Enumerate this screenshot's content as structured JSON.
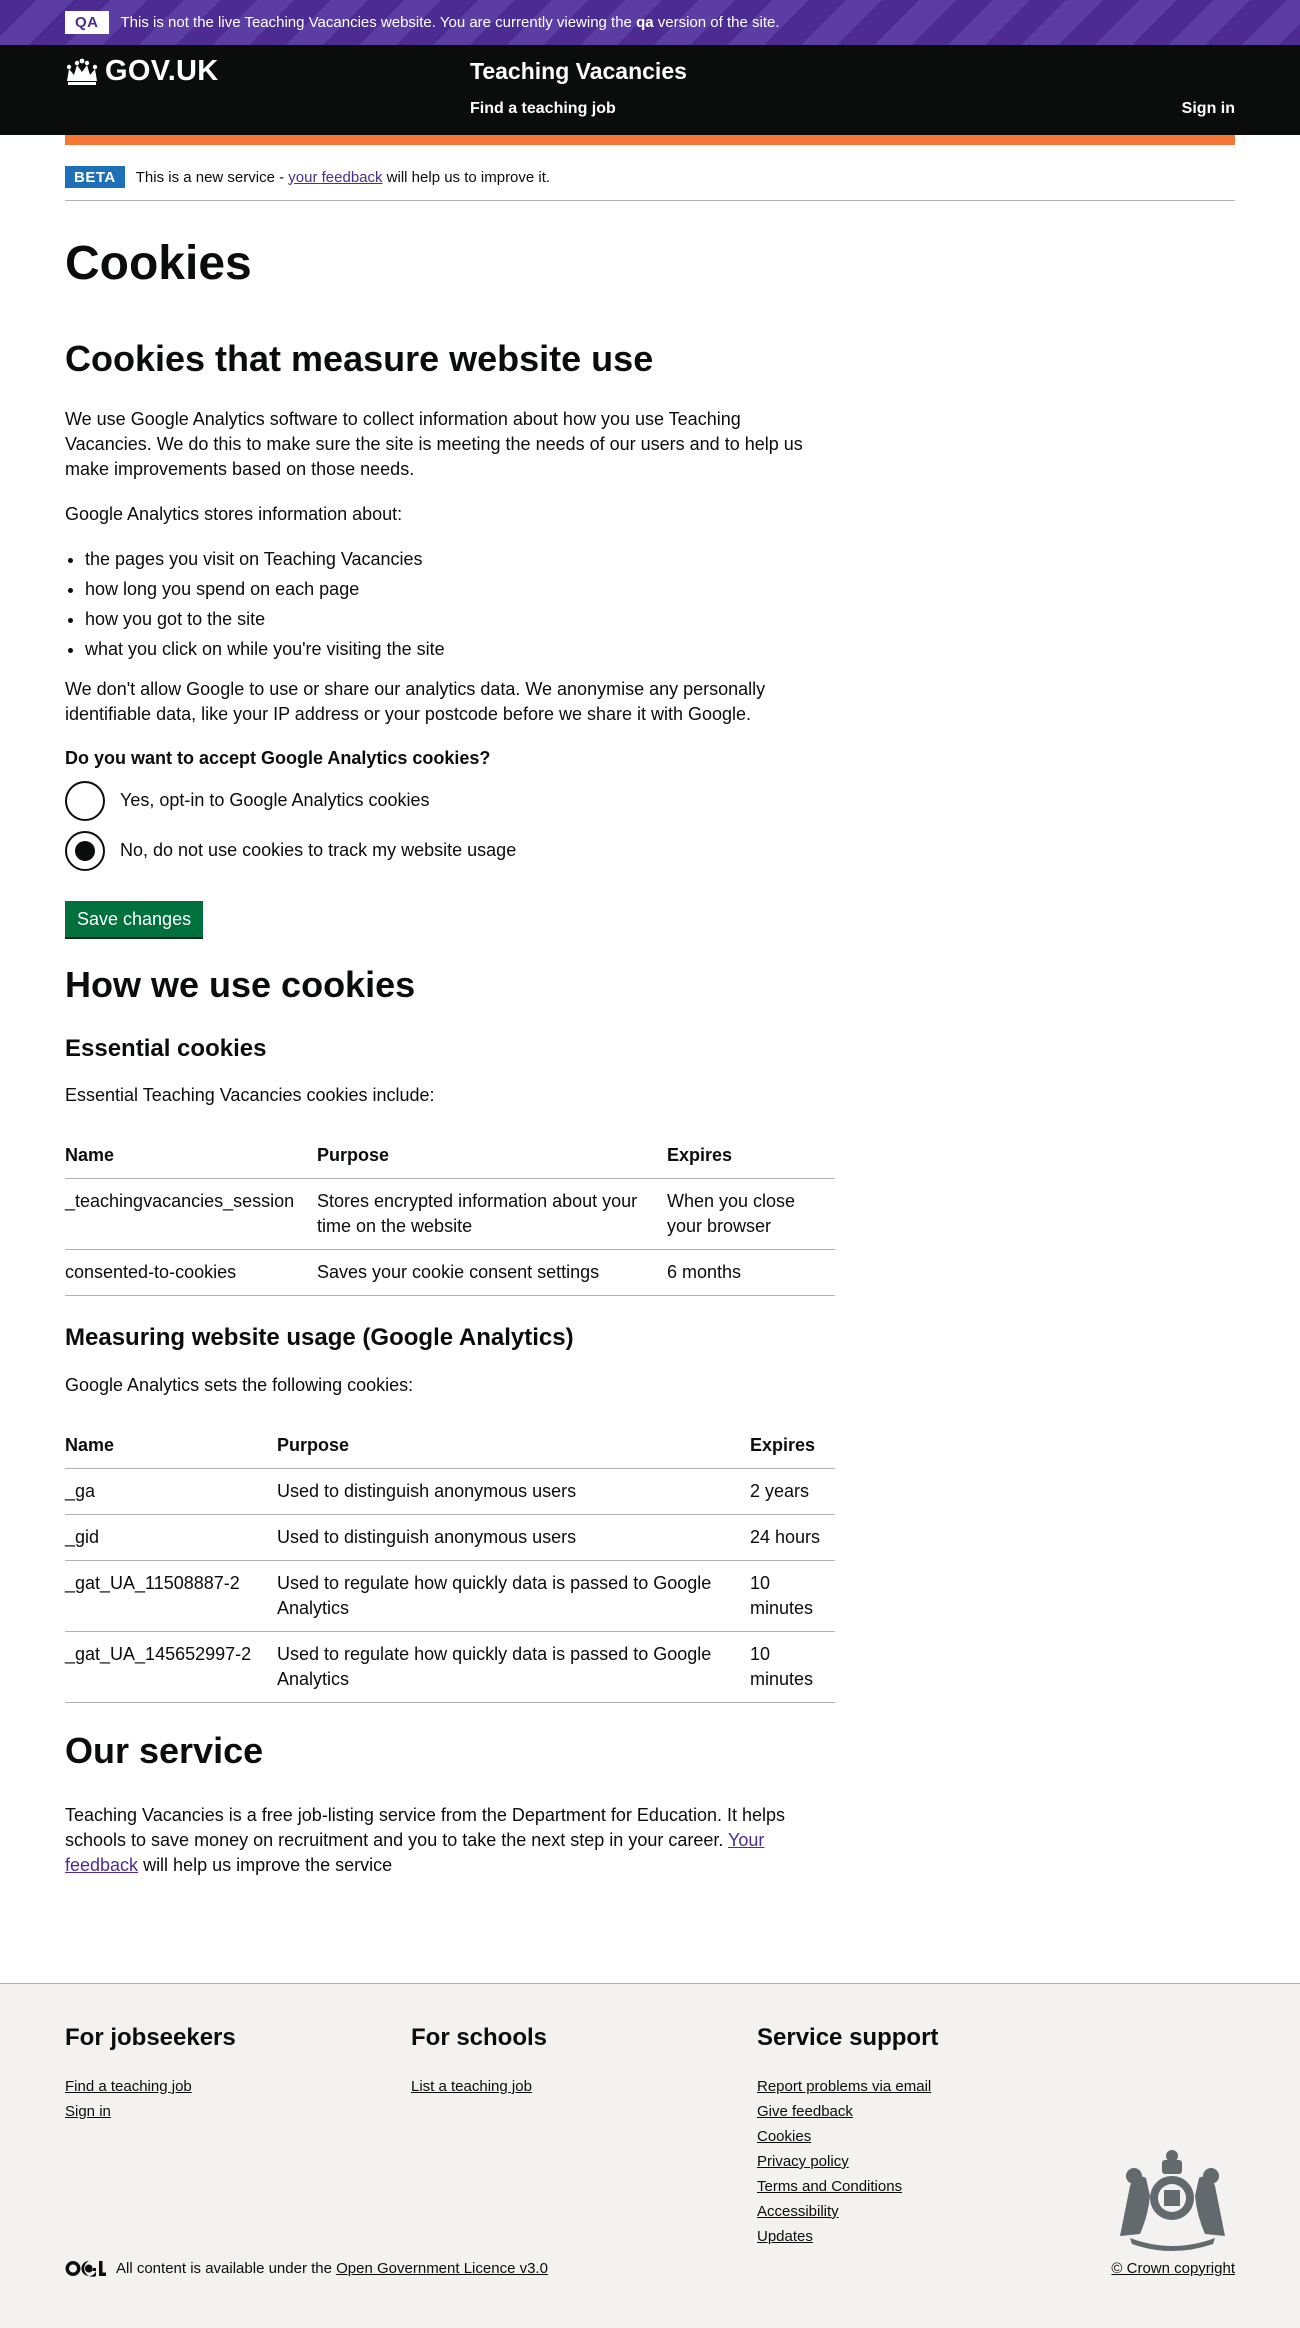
{
  "qa_banner": {
    "tag": "QA",
    "text_before": "This is not the live Teaching Vacancies website. You are currently viewing the ",
    "text_bold": "qa",
    "text_after": " version of the site."
  },
  "header": {
    "logo_text": "GOV.UK",
    "service_name": "Teaching Vacancies",
    "nav_find": "Find a teaching job",
    "nav_signin": "Sign in"
  },
  "phase_banner": {
    "tag": "BETA",
    "text_before": "This is a new service - ",
    "link": "your feedback",
    "text_after": " will help us to improve it."
  },
  "main": {
    "title": "Cookies",
    "measure": {
      "heading": "Cookies that measure website use",
      "intro": "We use Google Analytics software to collect information about how you use Teaching Vacancies. We do this to make sure the site is meeting the needs of our users and to help us make improvements based on those needs.",
      "stores_intro": "Google Analytics stores information about:",
      "bullets": [
        "the pages you visit on Teaching Vacancies",
        "how long you spend on each page",
        "how you got to the site",
        "what you click on while you're visiting the site"
      ],
      "privacy": "We don't allow Google to use or share our analytics data. We anonymise any personally identifiable data, like your IP address or your postcode before we share it with Google.",
      "question": "Do you want to accept Google Analytics cookies?",
      "option_yes": "Yes, opt-in to Google Analytics cookies",
      "option_no": "No, do not use cookies to track my website usage",
      "selected": "no",
      "save_label": "Save changes"
    },
    "how": {
      "heading": "How we use cookies",
      "essential_heading": "Essential cookies",
      "essential_intro": "Essential Teaching Vacancies cookies include:",
      "essential_headers": [
        "Name",
        "Purpose",
        "Expires"
      ],
      "essential_rows": [
        [
          "_teachingvacancies_session",
          "Stores encrypted information about your time on the website",
          "When you close your browser"
        ],
        [
          "consented-to-cookies",
          "Saves your cookie consent settings",
          "6 months"
        ]
      ],
      "ga_heading": "Measuring website usage (Google Analytics)",
      "ga_intro": "Google Analytics sets the following cookies:",
      "ga_headers": [
        "Name",
        "Purpose",
        "Expires"
      ],
      "ga_rows": [
        [
          "_ga",
          "Used to distinguish anonymous users",
          "2 years"
        ],
        [
          "_gid",
          "Used to distinguish anonymous users",
          "24 hours"
        ],
        [
          "_gat_UA_11508887-2",
          "Used to regulate how quickly data is passed to Google Analytics",
          "10 minutes"
        ],
        [
          "_gat_UA_145652997-2",
          "Used to regulate how quickly data is passed to Google Analytics",
          "10 minutes"
        ]
      ]
    },
    "service": {
      "heading": "Our service",
      "text_before": "Teaching Vacancies is a free job-listing service from the Department for Education. It helps schools to save money on recruitment and you to take the next step in your career. ",
      "link": "Your feedback",
      "text_after": " will help us improve the service"
    }
  },
  "footer": {
    "jobseekers": {
      "heading": "For jobseekers",
      "links": [
        "Find a teaching job",
        "Sign in"
      ]
    },
    "schools": {
      "heading": "For schools",
      "links": [
        "List a teaching job"
      ]
    },
    "support": {
      "heading": "Service support",
      "links": [
        "Report problems via email",
        "Give feedback",
        "Cookies",
        "Privacy policy",
        "Terms and Conditions",
        "Accessibility",
        "Updates"
      ]
    },
    "licence_before": "All content is available under the ",
    "licence_link": "Open Government Licence v3.0",
    "copyright": "© Crown copyright"
  }
}
